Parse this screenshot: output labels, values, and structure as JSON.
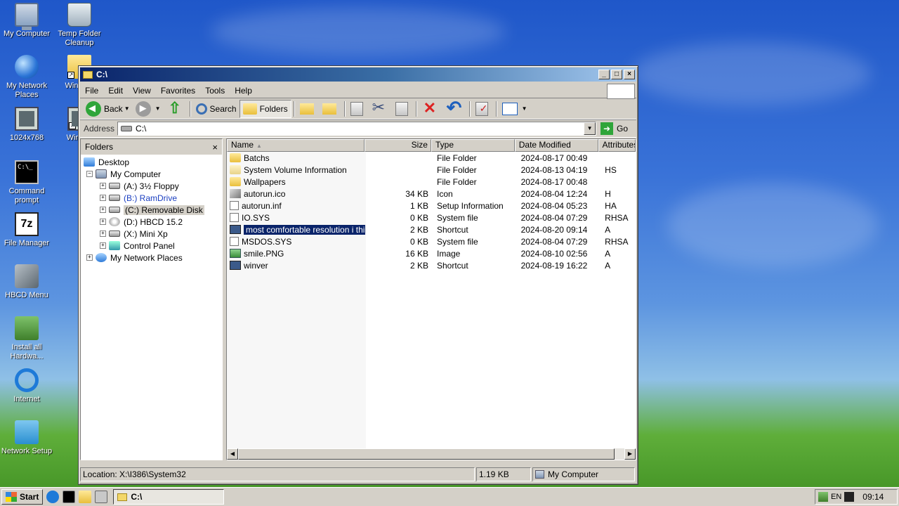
{
  "desktop": {
    "icons": [
      {
        "label": "My Computer",
        "icon": "computer-icon"
      },
      {
        "label": "Temp Folder Cleanup",
        "icon": "recycle-bin-icon"
      },
      {
        "label": "My Network Places",
        "icon": "network-places-icon"
      },
      {
        "label": "Win Exp",
        "icon": "folder-icon"
      },
      {
        "label": "1024x768",
        "icon": "monitor-icon"
      },
      {
        "label": "Wireles",
        "icon": "wireless-icon"
      },
      {
        "label": "Command prompt",
        "icon": "command-prompt-icon"
      },
      {
        "label": "File Manager",
        "icon": "7zip-icon"
      },
      {
        "label": "HBCD Menu",
        "icon": "tools-icon"
      },
      {
        "label": "Install all Hardwa...",
        "icon": "hardware-icon"
      },
      {
        "label": "Internet",
        "icon": "internet-explorer-icon"
      },
      {
        "label": "Network Setup",
        "icon": "network-setup-icon"
      }
    ]
  },
  "window": {
    "title": "C:\\",
    "caption": {
      "minimize": "_",
      "maximize": "□",
      "close": "×"
    },
    "menu": [
      "File",
      "Edit",
      "View",
      "Favorites",
      "Tools",
      "Help"
    ],
    "toolbar": {
      "back": "Back",
      "search": "Search",
      "folders": "Folders"
    },
    "address": {
      "label": "Address",
      "value": "C:\\",
      "go": "Go"
    },
    "folders_pane": {
      "title": "Folders",
      "close": "×",
      "tree": [
        {
          "label": "Desktop",
          "level": 0,
          "expander": ""
        },
        {
          "label": "My Computer",
          "level": 1,
          "expander": "−"
        },
        {
          "label": "(A:) 3½ Floppy",
          "level": 2,
          "expander": "+"
        },
        {
          "label": "(B:) RamDrive",
          "level": 2,
          "expander": "+"
        },
        {
          "label": "(C:) Removable Disk",
          "level": 2,
          "expander": "+"
        },
        {
          "label": "(D:) HBCD 15.2",
          "level": 2,
          "expander": "+"
        },
        {
          "label": "(X:) Mini Xp",
          "level": 2,
          "expander": "+"
        },
        {
          "label": "Control Panel",
          "level": 2,
          "expander": "+"
        },
        {
          "label": "My Network Places",
          "level": 1,
          "expander": "+"
        }
      ]
    },
    "file_list": {
      "columns": [
        "Name",
        "Size",
        "Type",
        "Date Modified",
        "Attributes"
      ],
      "rows": [
        {
          "name": "Batchs",
          "size": "",
          "type": "File Folder",
          "date": "2024-08-17 00:49",
          "attr": ""
        },
        {
          "name": "System Volume Information",
          "size": "",
          "type": "File Folder",
          "date": "2024-08-13 04:19",
          "attr": "HS"
        },
        {
          "name": "Wallpapers",
          "size": "",
          "type": "File Folder",
          "date": "2024-08-17 00:48",
          "attr": ""
        },
        {
          "name": "autorun.ico",
          "size": "34 KB",
          "type": "Icon",
          "date": "2024-08-04 12:24",
          "attr": "H"
        },
        {
          "name": "autorun.inf",
          "size": "1 KB",
          "type": "Setup Information",
          "date": "2024-08-04 05:23",
          "attr": "HA"
        },
        {
          "name": "IO.SYS",
          "size": "0 KB",
          "type": "System file",
          "date": "2024-08-04 07:29",
          "attr": "RHSA"
        },
        {
          "name": "most comfortable resolution i think.",
          "size": "2 KB",
          "type": "Shortcut",
          "date": "2024-08-20 09:14",
          "attr": "A"
        },
        {
          "name": "MSDOS.SYS",
          "size": "0 KB",
          "type": "System file",
          "date": "2024-08-04 07:29",
          "attr": "RHSA"
        },
        {
          "name": "smile.PNG",
          "size": "16 KB",
          "type": "Image",
          "date": "2024-08-10 02:56",
          "attr": "A"
        },
        {
          "name": "winver",
          "size": "2 KB",
          "type": "Shortcut",
          "date": "2024-08-19 16:22",
          "attr": "A"
        }
      ]
    },
    "status": {
      "location": "Location: X:\\I386\\System32",
      "size": "1.19 KB",
      "zone": "My Computer"
    }
  },
  "taskbar": {
    "start": "Start",
    "task": "C:\\",
    "tray_lang": "EN",
    "clock": "09:14"
  }
}
